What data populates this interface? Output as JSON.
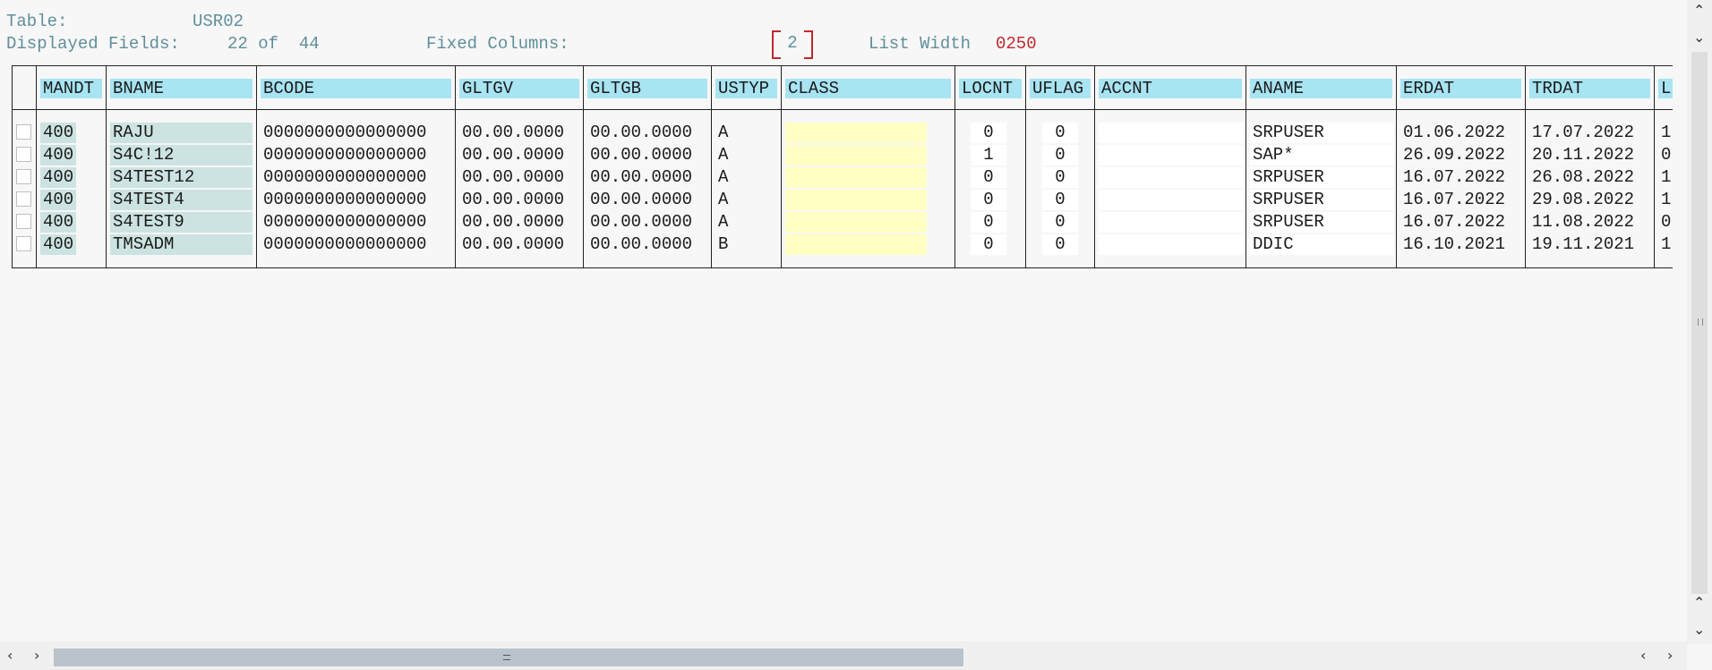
{
  "header": {
    "table_label": "Table:",
    "table_value": "USR02",
    "displayed_label": "Displayed Fields:",
    "displayed_value": "22 of  44",
    "fixed_label": "Fixed Columns:",
    "fixed_value": "2",
    "list_width_label": "List Width",
    "list_width_value": "0250"
  },
  "columns": [
    "MANDT",
    "BNAME",
    "BCODE",
    "GLTGV",
    "GLTGB",
    "USTYP",
    "CLASS",
    "LOCNT",
    "UFLAG",
    "ACCNT",
    "ANAME",
    "ERDAT",
    "TRDAT",
    "L"
  ],
  "rows": [
    {
      "mandt": "400",
      "bname": "RAJU",
      "bcode": "0000000000000000",
      "gltgv": "00.00.0000",
      "gltgb": "00.00.0000",
      "ustyp": "A",
      "class": "",
      "locnt": "0",
      "uflag": "0",
      "accnt": "",
      "aname": "SRPUSER",
      "erdat": "01.06.2022",
      "trdat": "17.07.2022",
      "l": "1"
    },
    {
      "mandt": "400",
      "bname": "S4C!12",
      "bcode": "0000000000000000",
      "gltgv": "00.00.0000",
      "gltgb": "00.00.0000",
      "ustyp": "A",
      "class": "",
      "locnt": "1",
      "uflag": "0",
      "accnt": "",
      "aname": "SAP*",
      "erdat": "26.09.2022",
      "trdat": "20.11.2022",
      "l": "0"
    },
    {
      "mandt": "400",
      "bname": "S4TEST12",
      "bcode": "0000000000000000",
      "gltgv": "00.00.0000",
      "gltgb": "00.00.0000",
      "ustyp": "A",
      "class": "",
      "locnt": "0",
      "uflag": "0",
      "accnt": "",
      "aname": "SRPUSER",
      "erdat": "16.07.2022",
      "trdat": "26.08.2022",
      "l": "1"
    },
    {
      "mandt": "400",
      "bname": "S4TEST4",
      "bcode": "0000000000000000",
      "gltgv": "00.00.0000",
      "gltgb": "00.00.0000",
      "ustyp": "A",
      "class": "",
      "locnt": "0",
      "uflag": "0",
      "accnt": "",
      "aname": "SRPUSER",
      "erdat": "16.07.2022",
      "trdat": "29.08.2022",
      "l": "1"
    },
    {
      "mandt": "400",
      "bname": "S4TEST9",
      "bcode": "0000000000000000",
      "gltgv": "00.00.0000",
      "gltgb": "00.00.0000",
      "ustyp": "A",
      "class": "",
      "locnt": "0",
      "uflag": "0",
      "accnt": "",
      "aname": "SRPUSER",
      "erdat": "16.07.2022",
      "trdat": "11.08.2022",
      "l": "0"
    },
    {
      "mandt": "400",
      "bname": "TMSADM",
      "bcode": "0000000000000000",
      "gltgv": "00.00.0000",
      "gltgb": "00.00.0000",
      "ustyp": "B",
      "class": "",
      "locnt": "0",
      "uflag": "0",
      "accnt": "",
      "aname": "DDIC",
      "erdat": "16.10.2021",
      "trdat": "19.11.2021",
      "l": "1"
    }
  ],
  "colors": {
    "header_bg": "#a8e4f2",
    "key_bg": "#cce3e1",
    "class_bg": "#ffffc4",
    "accent": "#c0282e"
  }
}
